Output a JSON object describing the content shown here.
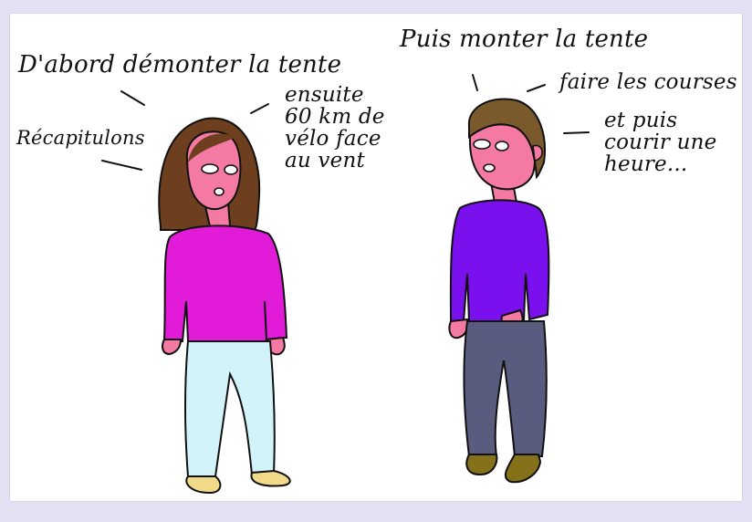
{
  "comic": {
    "left_character": {
      "speech": [
        "D'abord démonter la tente",
        "Récapitulons",
        "ensuite\n60 km de\nvélo face\nau vent"
      ],
      "colors": {
        "skin": "#f47aa3",
        "hair": "#6e3f1f",
        "shirt": "#e21bd8",
        "pants": "#d3f3fb",
        "shoes": "#f1db8a"
      }
    },
    "right_character": {
      "speech": [
        "Puis monter la tente",
        "faire les courses",
        "et puis\ncourir une\nheure..."
      ],
      "colors": {
        "skin": "#f47aa3",
        "hair": "#7a5a2c",
        "shirt": "#7a10ee",
        "pants": "#5a5c7f",
        "shoes": "#85711a"
      }
    },
    "border_color": "#e3e0f3"
  }
}
